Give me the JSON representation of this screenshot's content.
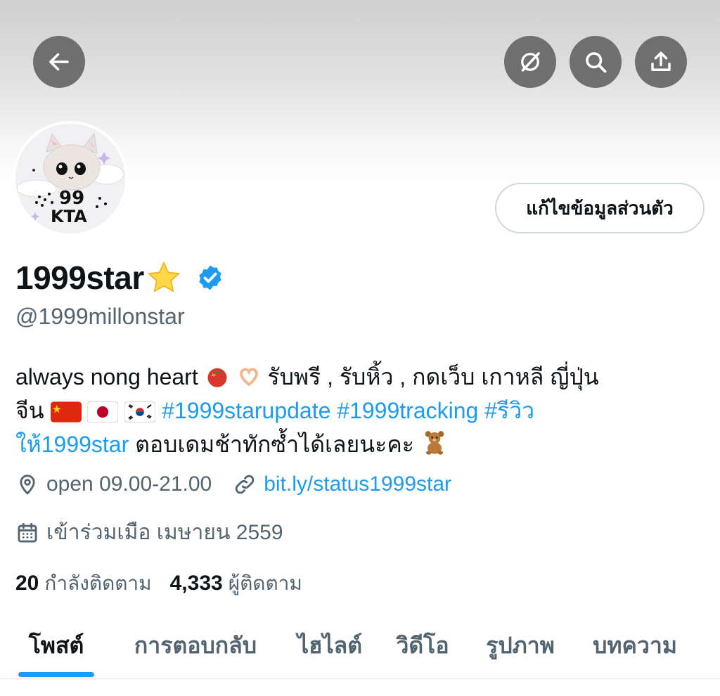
{
  "header": {
    "back_icon": "arrow-left-icon",
    "grok_icon": "grok-icon",
    "search_icon": "search-icon",
    "share_icon": "share-icon",
    "button_color": "#6f6f6f"
  },
  "profile": {
    "avatar_text": "99 KTA",
    "edit_profile_label": "แก้ไขข้อมูลส่วนตัว",
    "display_name": "1999star",
    "handle": "@1999millonstar",
    "verified_color": "#1d9bf0"
  },
  "bio": {
    "line1_text": "always nong heart",
    "line1_thai": "รับพรี , รับหิ้ว , กดเว็บ เกาหลี ญี่ปุ่น",
    "line2_prefix": "จีน",
    "hashtags": "#1999starupdate #1999tracking #รีวิว",
    "line3_link": "ให้1999star",
    "line3_text": "ตอบเดมช้าทักซ้ำได้เลยนะคะ"
  },
  "meta": {
    "hours": "open 09.00-21.00",
    "website": "bit.ly/status1999star",
    "joined": "เข้าร่วมเมือ เมษายน 2559"
  },
  "stats": {
    "following_count": "20",
    "following_label": "กำลังติดตาม",
    "followers_count": "4,333",
    "followers_label": "ผู้ติดตาม"
  },
  "tabs": [
    {
      "label": "โพสต์",
      "active": true
    },
    {
      "label": "การตอบกลับ",
      "active": false
    },
    {
      "label": "ไฮไลต์",
      "active": false
    },
    {
      "label": "วิดีโอ",
      "active": false
    },
    {
      "label": "รูปภาพ",
      "active": false
    },
    {
      "label": "บทความ",
      "active": false
    }
  ],
  "colors": {
    "accent": "#1d9bf0",
    "text_primary": "#0f1419",
    "text_secondary": "#536471"
  }
}
